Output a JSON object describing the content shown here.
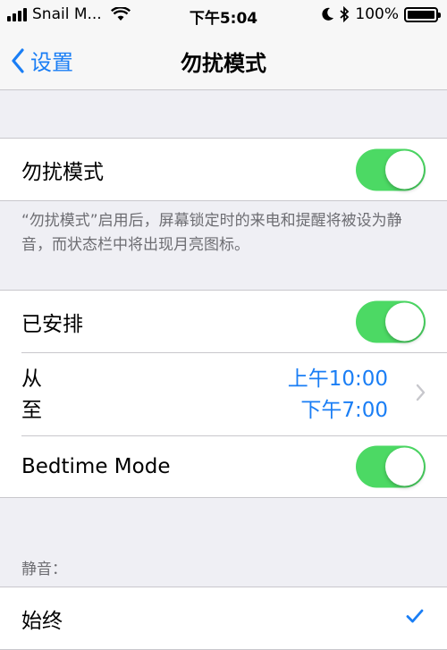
{
  "status_bar": {
    "carrier": "Snail M...",
    "time": "下午5:04",
    "battery": "100%",
    "signal_icon": "signal-bars-icon",
    "wifi_icon": "wifi-icon"
  },
  "nav": {
    "back_label": "设置",
    "title": "勿扰模式"
  },
  "dnd": {
    "label": "勿扰模式",
    "enabled": true,
    "footer": "“勿扰模式”启用后，屏幕锁定时的来电和提醒将被设为静音，而状态栏中将出现月亮图标。"
  },
  "schedule": {
    "scheduled_label": "已安排",
    "scheduled_enabled": true,
    "from_label": "从",
    "to_label": "至",
    "from_value": "上午10:00",
    "to_value": "下午7:00",
    "bedtime_label": "Bedtime Mode",
    "bedtime_enabled": true
  },
  "silence": {
    "header": "静音：",
    "always_label": "始终",
    "always_checked": true
  },
  "colors": {
    "accent": "#1a7ef5",
    "toggle_on": "#4cd964",
    "background": "#efeff4",
    "secondary_text": "#6d6d72"
  }
}
